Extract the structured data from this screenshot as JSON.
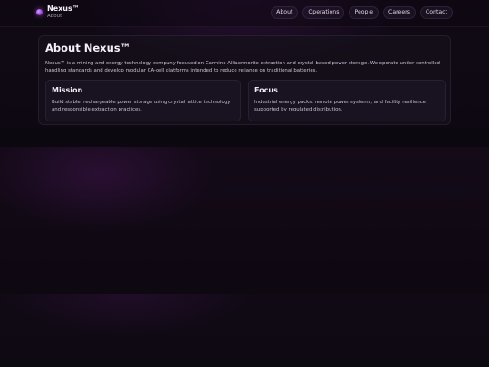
{
  "header": {
    "brand_name": "Nexus™",
    "brand_sub": "About",
    "nav": [
      "About",
      "Operations",
      "People",
      "Careers",
      "Contact"
    ]
  },
  "main": {
    "title": "About Nexus™",
    "intro": "Nexus™ is a mining and energy technology company focused on Carmine Alliaermorite extraction and crystal-based power storage. We operate under controlled handling standards and develop modular CA-cell platforms intended to reduce reliance on traditional batteries.",
    "cards": [
      {
        "title": "Mission",
        "text": "Build stable, rechargeable power storage using crystal lattice technology and responsible extraction practices."
      },
      {
        "title": "Focus",
        "text": "Industrial energy packs, remote power systems, and facility resilience supported by regulated distribution."
      }
    ]
  },
  "colors": {
    "background": "#0a0710",
    "accent": "#9a3fd6"
  },
  "icons": {
    "brand": "nexus-logo-dot-icon"
  }
}
